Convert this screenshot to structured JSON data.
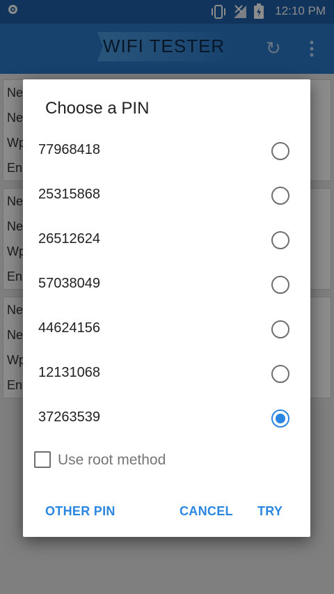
{
  "status_bar": {
    "time": "12:10 PM",
    "icons": [
      "notification-icon",
      "vibrate-icon",
      "no-signal-icon",
      "battery-charging-icon"
    ]
  },
  "toolbar": {
    "title": "WIFI TESTER",
    "icons": [
      "refresh-icon",
      "overflow-menu-icon"
    ]
  },
  "background_cards": [
    [
      "Ne",
      "Ne",
      "Wp",
      "En"
    ],
    [
      "Ne",
      "Ne",
      "Wp",
      "En"
    ],
    [
      "Ne",
      "Ne",
      "Wp",
      "En"
    ]
  ],
  "dialog": {
    "title": "Choose a PIN",
    "pins": [
      {
        "value": "77968418",
        "selected": false
      },
      {
        "value": "25315868",
        "selected": false
      },
      {
        "value": "26512624",
        "selected": false
      },
      {
        "value": "57038049",
        "selected": false
      },
      {
        "value": "44624156",
        "selected": false
      },
      {
        "value": "12131068",
        "selected": false
      },
      {
        "value": "37263539",
        "selected": true
      }
    ],
    "root_method": {
      "label": "Use root method",
      "checked": false
    },
    "buttons": {
      "other_pin": "OTHER PIN",
      "cancel": "CANCEL",
      "try": "TRY"
    }
  },
  "colors": {
    "accent": "#2a86e0",
    "toolbar": "#2a78c9",
    "status_bar": "#1e5fa8"
  }
}
